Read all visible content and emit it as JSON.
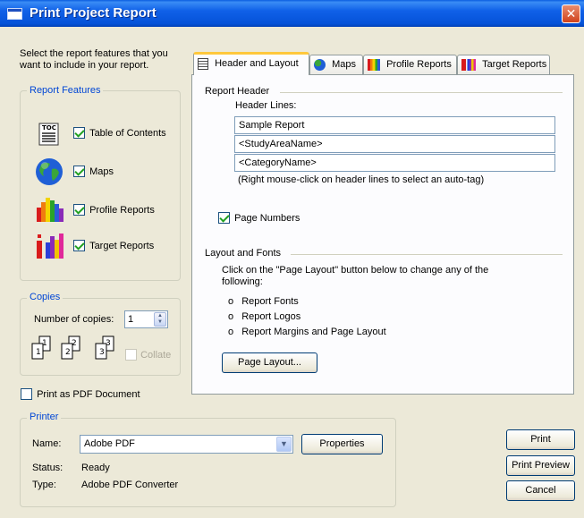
{
  "window": {
    "title": "Print Project Report"
  },
  "intro": "Select the report features that you want to include in your report.",
  "features": {
    "legend": "Report Features",
    "items": [
      {
        "label": "Table of Contents",
        "checked": true,
        "icon": "toc-icon"
      },
      {
        "label": "Maps",
        "checked": true,
        "icon": "globe-icon"
      },
      {
        "label": "Profile Reports",
        "checked": true,
        "icon": "profile-report-icon"
      },
      {
        "label": "Target Reports",
        "checked": true,
        "icon": "target-report-icon"
      }
    ]
  },
  "copies": {
    "legend": "Copies",
    "label": "Number of copies:",
    "value": "1",
    "collate_label": "Collate",
    "collate_checked": false
  },
  "print_pdf": {
    "label": "Print as PDF Document",
    "checked": false
  },
  "printer": {
    "legend": "Printer",
    "name_label": "Name:",
    "name_value": "Adobe PDF",
    "properties_label": "Properties",
    "status_label": "Status:",
    "status_value": "Ready",
    "type_label": "Type:",
    "type_value": "Adobe PDF Converter"
  },
  "tabs": [
    {
      "label": "Header and Layout",
      "active": true,
      "icon": "document-icon"
    },
    {
      "label": "Maps",
      "active": false,
      "icon": "globe-icon"
    },
    {
      "label": "Profile Reports",
      "active": false,
      "icon": "profile-report-icon"
    },
    {
      "label": "Target Reports",
      "active": false,
      "icon": "target-report-icon"
    }
  ],
  "header_layout": {
    "report_header_title": "Report Header",
    "header_lines_label": "Header Lines:",
    "header_lines": [
      "Sample Report",
      "<StudyAreaName>",
      "<CategoryName>"
    ],
    "hint": "(Right mouse-click on header lines to select an auto-tag)",
    "page_numbers_label": "Page Numbers",
    "page_numbers_checked": true,
    "layout_fonts_title": "Layout and Fonts",
    "layout_desc": "Click on the \"Page Layout\" button below to change any of the following:",
    "bullets": [
      "Report Fonts",
      "Report Logos",
      "Report Margins and Page Layout"
    ],
    "bullet_char": "o",
    "page_layout_button": "Page Layout..."
  },
  "buttons": {
    "print": "Print",
    "preview": "Print Preview",
    "cancel": "Cancel"
  }
}
